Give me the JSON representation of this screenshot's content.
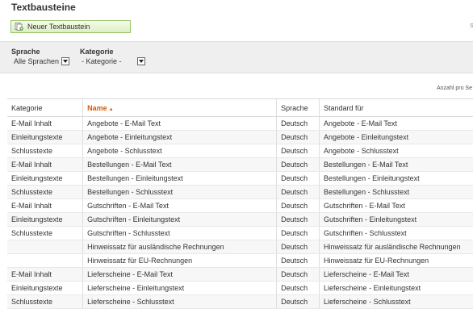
{
  "page": {
    "title": "Textbausteine"
  },
  "toolbar": {
    "new_label": "Neuer Textbaustein",
    "new_icon": "add-document-icon",
    "right_glyph": "S"
  },
  "filters": {
    "language": {
      "label": "Sprache",
      "value": "Alle Sprachen"
    },
    "category": {
      "label": "Kategorie",
      "value": "- Kategorie -"
    }
  },
  "count_label": "Anzahl pro Se",
  "table": {
    "headers": [
      "Kategorie",
      "Name",
      "Sprache",
      "Standard für"
    ],
    "sort_indicator": "▲",
    "rows": [
      [
        "E-Mail Inhalt",
        "Angebote - E-Mail Text",
        "Deutsch",
        "Angebote - E-Mail Text"
      ],
      [
        "Einleitungstexte",
        "Angebote - Einleitungstext",
        "Deutsch",
        "Angebote - Einleitungstext"
      ],
      [
        "Schlusstexte",
        "Angebote - Schlusstext",
        "Deutsch",
        "Angebote - Schlusstext"
      ],
      [
        "E-Mail Inhalt",
        "Bestellungen - E-Mail Text",
        "Deutsch",
        "Bestellungen - E-Mail Text"
      ],
      [
        "Einleitungstexte",
        "Bestellungen - Einleitungstext",
        "Deutsch",
        "Bestellungen - Einleitungstext"
      ],
      [
        "Schlusstexte",
        "Bestellungen - Schlusstext",
        "Deutsch",
        "Bestellungen - Schlusstext"
      ],
      [
        "E-Mail Inhalt",
        "Gutschriften - E-Mail Text",
        "Deutsch",
        "Gutschriften - E-Mail Text"
      ],
      [
        "Einleitungstexte",
        "Gutschriften - Einleitungstext",
        "Deutsch",
        "Gutschriften - Einleitungstext"
      ],
      [
        "Schlusstexte",
        "Gutschriften - Schlusstext",
        "Deutsch",
        "Gutschriften - Schlusstext"
      ],
      [
        "",
        "Hinweissatz für ausländische Rechnungen",
        "Deutsch",
        "Hinweissatz für ausländische Rechnungen"
      ],
      [
        "",
        "Hinweissatz für EU-Rechnungen",
        "Deutsch",
        "Hinweissatz für EU-Rechnungen"
      ],
      [
        "E-Mail Inhalt",
        "Lieferscheine - E-Mail Text",
        "Deutsch",
        "Lieferscheine - E-Mail Text"
      ],
      [
        "Einleitungstexte",
        "Lieferscheine - Einleitungstext",
        "Deutsch",
        "Lieferscheine - Einleitungstext"
      ],
      [
        "Schlusstexte",
        "Lieferscheine - Schlusstext",
        "Deutsch",
        "Lieferscheine - Schlusstext"
      ]
    ]
  }
}
